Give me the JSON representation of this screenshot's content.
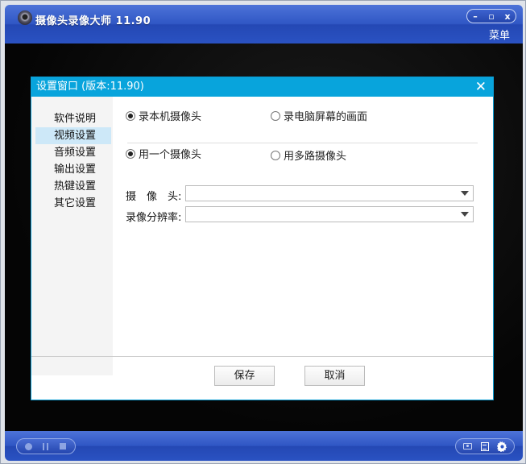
{
  "app": {
    "title": "摄像头录像大师 11.90",
    "menu_label": "菜单",
    "controls": {
      "minimize": "–",
      "maximize": "▫",
      "close": "x"
    }
  },
  "dialog": {
    "title": "设置窗口 (版本:11.90)",
    "close_glyph": "✕",
    "sidebar": {
      "items": [
        {
          "label": "软件说明",
          "active": false
        },
        {
          "label": "视频设置",
          "active": true
        },
        {
          "label": "音频设置",
          "active": false
        },
        {
          "label": "输出设置",
          "active": false
        },
        {
          "label": "热键设置",
          "active": false
        },
        {
          "label": "其它设置",
          "active": false
        }
      ]
    },
    "video_settings": {
      "source": {
        "options": [
          {
            "label": "录本机摄像头",
            "checked": true
          },
          {
            "label": "录电脑屏幕的画面",
            "checked": false
          }
        ]
      },
      "camera_mode": {
        "options": [
          {
            "label": "用一个摄像头",
            "checked": true
          },
          {
            "label": "用多路摄像头",
            "checked": false
          }
        ]
      },
      "camera_label": "摄　像　头:",
      "camera_value": "",
      "resolution_label": "录像分辨率:",
      "resolution_value": ""
    },
    "buttons": {
      "save": "保存",
      "cancel": "取消"
    }
  },
  "icons": {
    "logo": "webcam-logo-icon",
    "record": "record-icon",
    "pause": "pause-icon",
    "stop": "stop-icon",
    "snapshot": "camera-icon",
    "list": "list-icon",
    "settings": "gear-icon"
  },
  "colors": {
    "titlebar": "#2f56c4",
    "dialog_header": "#08a4dc",
    "sidebar_active": "#cde8f8"
  }
}
